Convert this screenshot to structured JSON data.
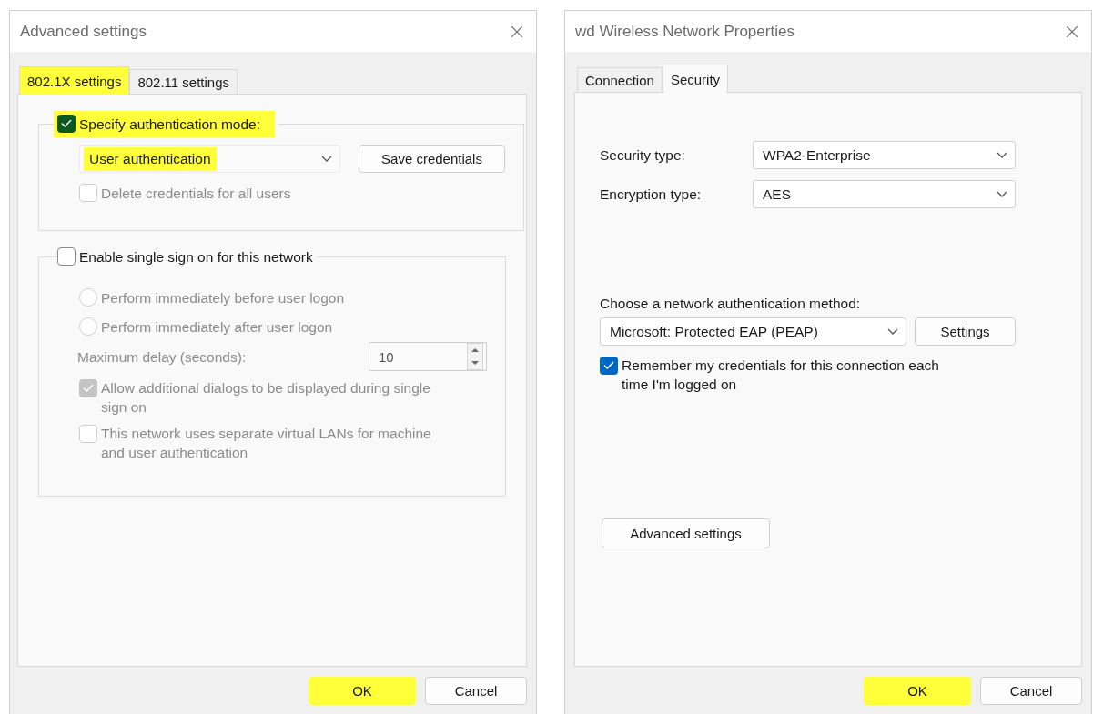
{
  "advanced_settings": {
    "title": "Advanced settings",
    "tabs": [
      {
        "label": "802.1X settings",
        "selected": true,
        "highlighted": true
      },
      {
        "label": "802.11 settings",
        "selected": false,
        "highlighted": false
      }
    ],
    "auth_group": {
      "checkbox": {
        "label": "Specify authentication mode:",
        "checked": true,
        "highlighted": true
      },
      "mode_select": {
        "value": "User authentication",
        "highlighted": true
      },
      "save_button": "Save credentials",
      "delete_checkbox": {
        "label": "Delete credentials for all users",
        "checked": false,
        "disabled": true
      }
    },
    "sso_group": {
      "checkbox": {
        "label": "Enable single sign on for this network",
        "checked": false
      },
      "radios": [
        {
          "label": "Perform immediately before user logon",
          "selected": false,
          "disabled": true
        },
        {
          "label": "Perform immediately after user logon",
          "selected": false,
          "disabled": true
        }
      ],
      "delay": {
        "label": "Maximum delay (seconds):",
        "value": "10",
        "disabled": true
      },
      "options": [
        {
          "label": "Allow additional dialogs to be displayed during single sign on",
          "checked": true,
          "disabled": true
        },
        {
          "label": "This network uses separate virtual LANs for machine and user authentication",
          "checked": false,
          "disabled": true
        }
      ]
    },
    "buttons": [
      {
        "label": "OK",
        "highlighted": true
      },
      {
        "label": "Cancel",
        "highlighted": false
      }
    ]
  },
  "network_properties": {
    "title": "wd Wireless Network Properties",
    "tabs": [
      {
        "label": "Connection",
        "selected": false
      },
      {
        "label": "Security",
        "selected": true
      }
    ],
    "fields": [
      {
        "label": "Security type:",
        "value": "WPA2-Enterprise"
      },
      {
        "label": "Encryption type:",
        "value": "AES"
      }
    ],
    "auth_method": {
      "label": "Choose a network authentication method:",
      "value": "Microsoft: Protected EAP (PEAP)",
      "settings_button": "Settings"
    },
    "remember": {
      "label": "Remember my credentials for this connection each time I'm logged on",
      "checked": true
    },
    "advanced_button": "Advanced settings",
    "buttons": [
      {
        "label": "OK",
        "highlighted": true
      },
      {
        "label": "Cancel",
        "highlighted": false
      }
    ]
  }
}
